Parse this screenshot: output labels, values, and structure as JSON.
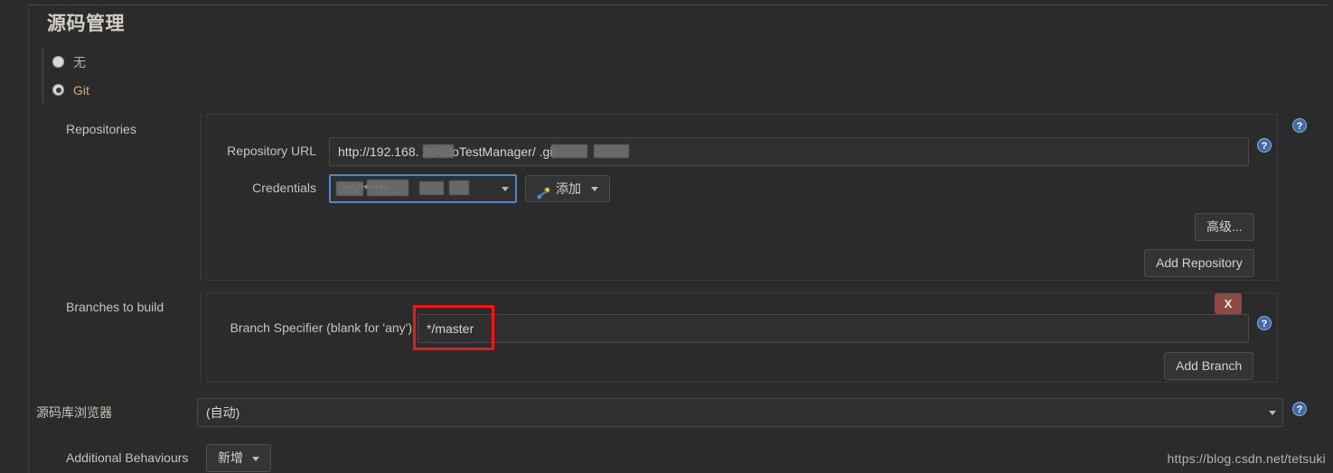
{
  "page": {
    "title": "源码管理",
    "watermark": "https://blog.csdn.net/tetsuki"
  },
  "scm_radio": {
    "options": [
      {
        "label": "无",
        "selected": false
      },
      {
        "label": "Git",
        "selected": true
      }
    ]
  },
  "repositories": {
    "section_label": "Repositories",
    "repository_url": {
      "label": "Repository URL",
      "value": "http://192.168.            2/AutoTestManager/                .git",
      "value_visible_parts": [
        "http://192.168.",
        "2/AutoTestManager/",
        ".git"
      ],
      "redacted": true
    },
    "credentials": {
      "label": "Credentials",
      "value": "                    .cn/******",
      "focused": true
    },
    "add_credentials_button": {
      "label": "添加",
      "icon": "key-icon",
      "has_dropdown": true
    },
    "advanced_button": {
      "label": "高级..."
    },
    "add_repository_button": {
      "label": "Add Repository"
    }
  },
  "branches": {
    "section_label": "Branches to build",
    "branch_specifier": {
      "label": "Branch Specifier (blank for 'any')",
      "value": "*/master",
      "highlighted": true,
      "highlight_color": "#f51313"
    },
    "delete_button": {
      "label": "X",
      "color": "#8d4a41"
    },
    "add_branch_button": {
      "label": "Add Branch"
    }
  },
  "repo_browser": {
    "label": "源码库浏览器",
    "value": "(自动)"
  },
  "additional_behaviours": {
    "label": "Additional Behaviours",
    "add_button": {
      "label": "新增",
      "has_dropdown": true
    }
  },
  "help_icons": {
    "name": "help-icon",
    "color": "#3f6aa8"
  }
}
